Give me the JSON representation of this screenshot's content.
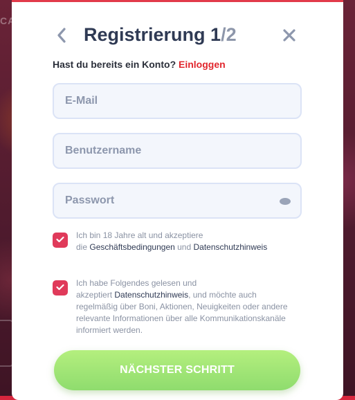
{
  "background": {
    "partial_text": "CA"
  },
  "header": {
    "title": "Registrierung",
    "step_current": "1",
    "step_separator": "/",
    "step_total": "2",
    "back_icon": "chevron-left-icon",
    "close_icon": "close-icon"
  },
  "login_prompt": {
    "text": "Hast du bereits ein Konto?",
    "link": "Einloggen"
  },
  "form": {
    "email_placeholder": "E-Mail",
    "username_placeholder": "Benutzername",
    "password_placeholder": "Passwort",
    "password_toggle_icon": "eye-icon"
  },
  "consent": {
    "terms_checked": true,
    "terms_line1": "Ich bin 18 Jahre alt und akzeptiere",
    "terms_prefix": "die ",
    "terms_link1": "Geschäftsbedingungen",
    "terms_mid": " und ",
    "terms_link2": "Datenschutzhinweis",
    "marketing_checked": true,
    "marketing_line1": "Ich habe Folgendes gelesen und",
    "marketing_prefix": "akzeptiert ",
    "marketing_link": "Datenschutzhinweis",
    "marketing_rest": ", und möchte auch regelmäßig über Boni, Aktionen, Neuigkeiten oder andere relevante Informationen über alle Kommunikationskanäle informiert werden."
  },
  "next_button": {
    "label": "NÄCHSTER SCHRITT"
  },
  "colors": {
    "accent_red": "#e1262d",
    "checkbox": "#e03a5a",
    "button_green_top": "#b4ef7e",
    "button_green_bottom": "#8fdc6e",
    "title": "#2f3a54"
  }
}
